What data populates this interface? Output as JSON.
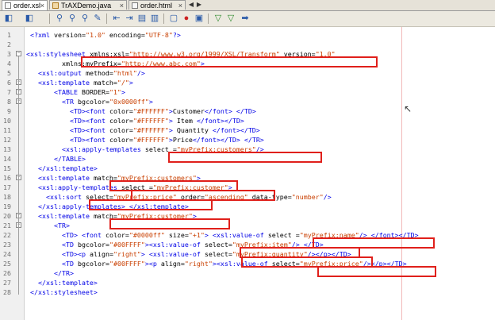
{
  "tabs": [
    {
      "label": "order.xsl",
      "icon": "xsl-file-icon",
      "active": true
    },
    {
      "label": "TrAXDemo.java",
      "icon": "java-file-icon",
      "active": false
    },
    {
      "label": "order.html",
      "icon": "html-file-icon",
      "active": false
    }
  ],
  "tab_close_glyph": "×",
  "toolbar": {
    "buttons": [
      "back-icon",
      "forward-icon",
      "search-icon",
      "find-previous-icon",
      "find-next-icon",
      "toggle-highlight-icon",
      "shift-left-icon",
      "shift-right-icon",
      "comment-icon",
      "macro-record-icon",
      "macro-stop-icon",
      "check-xml-icon",
      "validate-xml-icon",
      "xsl-transform-icon"
    ]
  },
  "colors": {
    "tag": "#0000e6",
    "attr_value": "#c93f00",
    "highlight": "#e0201b"
  },
  "lines": [
    {
      "num": "1",
      "indent": 1,
      "tokens": [
        [
          "t",
          "<?xml "
        ],
        [
          "a",
          "version="
        ],
        [
          "v",
          "\"1.0\""
        ],
        [
          "a",
          " encoding="
        ],
        [
          "v",
          "\"UTF-8\""
        ],
        [
          "t",
          "?>"
        ]
      ]
    },
    {
      "num": "2",
      "indent": 0,
      "tokens": []
    },
    {
      "num": "3",
      "indent": 0,
      "tokens": [
        [
          "t",
          "<xsl:stylesheet "
        ],
        [
          "a",
          "xmlns:xsl="
        ],
        [
          "v",
          "\"http://www.w3.org/1999/XSL/Transform\""
        ],
        [
          "a",
          " version="
        ],
        [
          "v",
          "\"1.0\""
        ]
      ]
    },
    {
      "num": "4",
      "indent": 9,
      "tokens": [
        [
          "a",
          "xmlns:myPrefix="
        ],
        [
          "v",
          "\"http://www.abc.com\""
        ],
        [
          "t",
          ">"
        ]
      ]
    },
    {
      "num": "5",
      "indent": 3,
      "tokens": [
        [
          "t",
          "<xsl:output "
        ],
        [
          "a",
          "method="
        ],
        [
          "v",
          "\"html\""
        ],
        [
          "t",
          "/>"
        ]
      ]
    },
    {
      "num": "6",
      "indent": 3,
      "tokens": [
        [
          "t",
          "<xsl:template "
        ],
        [
          "a",
          "match="
        ],
        [
          "v",
          "\"/\""
        ],
        [
          "t",
          ">"
        ]
      ]
    },
    {
      "num": "7",
      "indent": 7,
      "tokens": [
        [
          "t",
          "<TABLE "
        ],
        [
          "a",
          "BORDER="
        ],
        [
          "v",
          "\"1\""
        ],
        [
          "t",
          ">"
        ]
      ]
    },
    {
      "num": "8",
      "indent": 9,
      "tokens": [
        [
          "t",
          "<TR "
        ],
        [
          "a",
          "bgcolor="
        ],
        [
          "v",
          "\"0x0000ff\""
        ],
        [
          "t",
          ">"
        ]
      ]
    },
    {
      "num": "9",
      "indent": 11,
      "tokens": [
        [
          "t",
          "<TD><font "
        ],
        [
          "a",
          "color="
        ],
        [
          "v",
          "\"#FFFFFF\""
        ],
        [
          "t",
          ">"
        ],
        [
          "s",
          "Customer"
        ],
        [
          "t",
          "</font> </TD>"
        ]
      ]
    },
    {
      "num": "10",
      "indent": 11,
      "tokens": [
        [
          "t",
          "<TD><font "
        ],
        [
          "a",
          "color="
        ],
        [
          "v",
          "\"#FFFFFF\""
        ],
        [
          "t",
          ">"
        ],
        [
          "s",
          " Item "
        ],
        [
          "t",
          "</font></TD>"
        ]
      ]
    },
    {
      "num": "11",
      "indent": 11,
      "tokens": [
        [
          "t",
          "<TD><font "
        ],
        [
          "a",
          "color="
        ],
        [
          "v",
          "\"#FFFFFF\""
        ],
        [
          "t",
          ">"
        ],
        [
          "s",
          " Quantity "
        ],
        [
          "t",
          "</font></TD>"
        ]
      ]
    },
    {
      "num": "12",
      "indent": 11,
      "tokens": [
        [
          "t",
          "<TD><font "
        ],
        [
          "a",
          "color="
        ],
        [
          "v",
          "\"#FFFFFF\""
        ],
        [
          "t",
          ">"
        ],
        [
          "s",
          "Price"
        ],
        [
          "t",
          "</font></TD> </TR>"
        ]
      ]
    },
    {
      "num": "13",
      "indent": 9,
      "tokens": [
        [
          "t",
          "<xsl:apply-templates "
        ],
        [
          "a",
          "select "
        ],
        [
          "a",
          "="
        ],
        [
          "v",
          "\"myPrefix:customers\""
        ],
        [
          "t",
          "/>"
        ]
      ]
    },
    {
      "num": "14",
      "indent": 7,
      "tokens": [
        [
          "t",
          "</TABLE>"
        ]
      ]
    },
    {
      "num": "15",
      "indent": 3,
      "tokens": [
        [
          "t",
          "</xsl:template>"
        ]
      ]
    },
    {
      "num": "16",
      "indent": 3,
      "tokens": [
        [
          "t",
          "<xsl:template "
        ],
        [
          "a",
          "match="
        ],
        [
          "v",
          "\"myPrefix:customers\""
        ],
        [
          "t",
          ">"
        ]
      ]
    },
    {
      "num": "17",
      "indent": 3,
      "tokens": [
        [
          "t",
          "<xsl:apply-templates "
        ],
        [
          "a",
          "select "
        ],
        [
          "a",
          "="
        ],
        [
          "v",
          "\"myPrefix:customer\""
        ],
        [
          "t",
          ">"
        ]
      ]
    },
    {
      "num": "18",
      "indent": 5,
      "tokens": [
        [
          "t",
          "<xsl:sort "
        ],
        [
          "a",
          "select="
        ],
        [
          "v",
          "\"myPrefix:price\""
        ],
        [
          "a",
          " order="
        ],
        [
          "v",
          "\"ascending\""
        ],
        [
          "a",
          " data-type="
        ],
        [
          "v",
          "\"number\""
        ],
        [
          "t",
          "/>"
        ]
      ]
    },
    {
      "num": "19",
      "indent": 3,
      "tokens": [
        [
          "t",
          "</xsl:apply-templates> </xsl:template>"
        ]
      ]
    },
    {
      "num": "20",
      "indent": 3,
      "tokens": [
        [
          "t",
          "<xsl:template "
        ],
        [
          "a",
          "match="
        ],
        [
          "v",
          "\"myPrefix:customer\""
        ],
        [
          "t",
          ">"
        ]
      ]
    },
    {
      "num": "21",
      "indent": 7,
      "tokens": [
        [
          "t",
          "<TR>"
        ]
      ]
    },
    {
      "num": "22",
      "indent": 9,
      "tokens": [
        [
          "t",
          "<TD> <font "
        ],
        [
          "a",
          "color="
        ],
        [
          "v",
          "\"#0000ff\""
        ],
        [
          "a",
          " size="
        ],
        [
          "v",
          "\"+1\""
        ],
        [
          "t",
          "> <xsl:value-of "
        ],
        [
          "a",
          "select "
        ],
        [
          "a",
          "="
        ],
        [
          "v",
          "\"myPrefix:name\""
        ],
        [
          "t",
          "/> </font></TD>"
        ]
      ]
    },
    {
      "num": "23",
      "indent": 9,
      "tokens": [
        [
          "t",
          "<TD "
        ],
        [
          "a",
          "bgcolor="
        ],
        [
          "v",
          "\"#00FFFF\""
        ],
        [
          "t",
          "><xsl:value-of "
        ],
        [
          "a",
          "select="
        ],
        [
          "v",
          "\"myPrefix:item\""
        ],
        [
          "t",
          "/> </TD>"
        ]
      ]
    },
    {
      "num": "24",
      "indent": 9,
      "tokens": [
        [
          "t",
          "<TD><p "
        ],
        [
          "a",
          "align="
        ],
        [
          "v",
          "\"right\""
        ],
        [
          "t",
          "> <xsl:value-of "
        ],
        [
          "a",
          "select="
        ],
        [
          "v",
          "\"myPrefix:quantity\""
        ],
        [
          "t",
          "/></p></TD>"
        ]
      ]
    },
    {
      "num": "25",
      "indent": 9,
      "tokens": [
        [
          "t",
          "<TD "
        ],
        [
          "a",
          "bgcolor="
        ],
        [
          "v",
          "\"#00FFFF\""
        ],
        [
          "t",
          "><p "
        ],
        [
          "a",
          "align="
        ],
        [
          "v",
          "\"right\""
        ],
        [
          "t",
          "><xsl:value-of "
        ],
        [
          "a",
          "select="
        ],
        [
          "v",
          "\"myPrefix:price\""
        ],
        [
          "t",
          "/></p></TD>"
        ]
      ]
    },
    {
      "num": "26",
      "indent": 7,
      "tokens": [
        [
          "t",
          "</TR>"
        ]
      ]
    },
    {
      "num": "27",
      "indent": 3,
      "tokens": [
        [
          "t",
          "</xsl:template>"
        ]
      ]
    },
    {
      "num": "28",
      "indent": 1,
      "tokens": [
        [
          "t",
          "</xsl:stylesheet>"
        ]
      ]
    }
  ]
}
